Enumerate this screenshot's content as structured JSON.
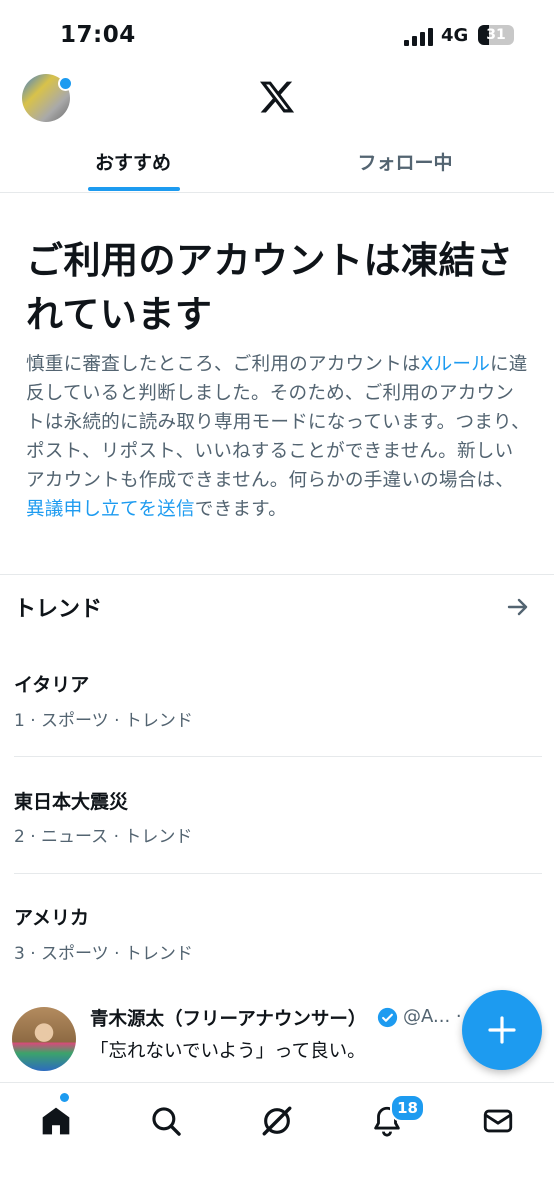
{
  "status_bar": {
    "time": "17:04",
    "network": "4G",
    "battery": "31"
  },
  "header": {
    "logo": "x-logo-icon"
  },
  "tabs": [
    {
      "label": "おすすめ",
      "active": true
    },
    {
      "label": "フォロー中",
      "active": false
    }
  ],
  "notice": {
    "title": "ご利用のアカウントは凍結されています",
    "body_1": "慎重に審査したところ、ご利用のアカウントは",
    "rules_link": "Xルール",
    "body_2": "に違反していると判断しました。そのため、ご利用のアカウントは永続的に読み取り専用モードになっています。つまり、ポスト、リポスト、いいねすることができません。新しいアカウントも作成できません。何らかの手違いの場合は、",
    "appeal_link": "異議申し立てを送信",
    "body_3": "できます。"
  },
  "trends": {
    "heading": "トレンド",
    "items": [
      {
        "name": "イタリア",
        "meta": "1 · スポーツ · トレンド"
      },
      {
        "name": "東日本大震災",
        "meta": "2 · ニュース · トレンド"
      },
      {
        "name": "アメリカ",
        "meta": "3 · スポーツ · トレンド"
      }
    ]
  },
  "tweet": {
    "author": "青木源太（フリーアナウンサー）",
    "handle": "@A... ·",
    "text": "「忘れないでいよう」って良い。"
  },
  "bottom_nav": {
    "items": [
      "home-icon",
      "search-icon",
      "grok-icon",
      "notifications-icon",
      "messages-icon"
    ],
    "notification_count": "18"
  },
  "colors": {
    "accent": "#1d9bf0",
    "text": "#0f1419",
    "secondary": "#536471"
  }
}
